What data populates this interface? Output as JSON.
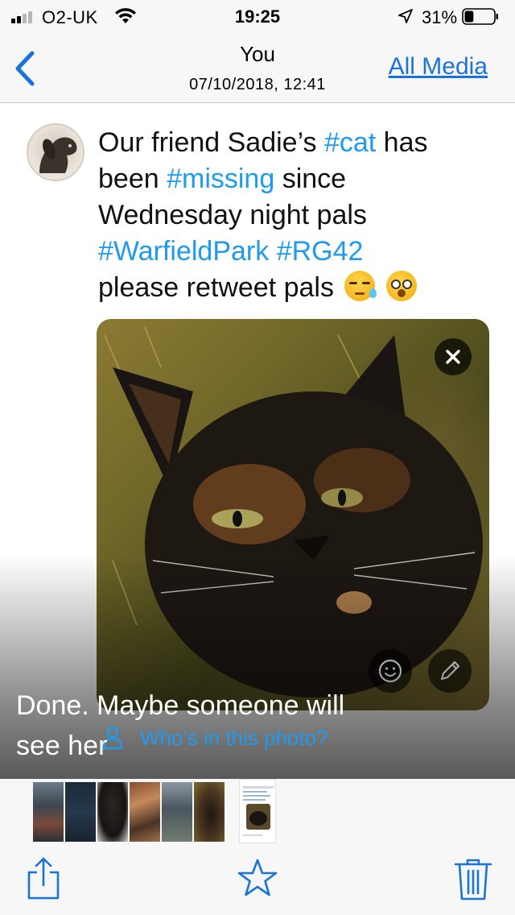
{
  "status_bar": {
    "carrier": "O2-UK",
    "time": "19:25",
    "battery_percent": "31%",
    "signal_bars_filled": 2,
    "signal_bars_total": 4,
    "battery_level": 0.31
  },
  "nav": {
    "back_icon": "chevron-left-icon",
    "title": "You",
    "subtitle": "07/10/2018, 12:41",
    "all_media_label": "All Media"
  },
  "tweet": {
    "line1_text": "Our friend Sadie’s ",
    "line1_hash": "#cat",
    "line1_tail": " has",
    "line2_text": "been ",
    "line2_hash": "#missing",
    "line2_tail": " since",
    "line3_text": "Wednesday night pals",
    "line4_hash1": "#WarfieldPark",
    "line4_space": " ",
    "line4_hash2": "#RG42",
    "line5_text": "please retweet pals",
    "emojis": [
      "sleepy-face-emoji",
      "flushed-face-emoji"
    ],
    "tag_people_label": "Who’s in this photo?"
  },
  "caption": {
    "line1": "Done. Maybe someone will",
    "line2": "see her"
  },
  "toolbar": {
    "items": [
      "share-icon",
      "favorite-star-icon",
      "trash-icon"
    ]
  },
  "colors": {
    "link_blue": "#1a73d9",
    "hashtag_blue": "#1d9bf0",
    "bar_bg": "#f7f7f7"
  }
}
